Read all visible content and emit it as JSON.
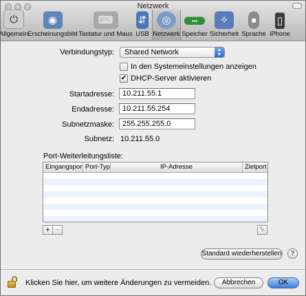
{
  "window": {
    "title": "Netzwerk"
  },
  "toolbar": {
    "items": [
      {
        "label": "Allgemein",
        "icon": "switch-icon",
        "color": "#bdbdbd"
      },
      {
        "label": "Erscheinungsbild",
        "icon": "monitor-icon",
        "color": "#5c86b8"
      },
      {
        "label": "Tastatur und Maus",
        "icon": "keyboard-icon",
        "color": "#9a9a9a"
      },
      {
        "label": "USB",
        "icon": "usb-icon",
        "color": "#4b76b8"
      },
      {
        "label": "Netzwerk",
        "icon": "globe-icon",
        "color": "#6d8fb6"
      },
      {
        "label": "Speicher",
        "icon": "memory-icon",
        "color": "#2f8f3f"
      },
      {
        "label": "Sicherheit",
        "icon": "wrench-icon",
        "color": "#5a7ab8"
      },
      {
        "label": "Sprache",
        "icon": "microphone-icon",
        "color": "#7d7d7d"
      },
      {
        "label": "iPhone",
        "icon": "phone-icon",
        "color": "#3a3a3a"
      }
    ]
  },
  "form": {
    "connection_type_label": "Verbindungstyp:",
    "connection_type_value": "Shared Network",
    "checkbox_show_label": "In den Systemeinstellungen anzeigen",
    "checkbox_show_checked": false,
    "checkbox_dhcp_label": "DHCP-Server aktivieren",
    "checkbox_dhcp_checked": true,
    "start_label": "Startadresse:",
    "start_value": "10.211.55.1",
    "end_label": "Endadresse:",
    "end_value": "10.211.55.254",
    "mask_label": "Subnetzmaske:",
    "mask_value": "255.255.255.0",
    "subnet_label": "Subnetz:",
    "subnet_value": "10.211.55.0"
  },
  "port_forwarding": {
    "title": "Port-Weiterleitungsliste:",
    "columns": [
      "Eingangsport",
      "Port-Typ",
      "IP-Adresse",
      "Zielport"
    ],
    "add_label": "+",
    "remove_label": "−",
    "edit_label": "✎"
  },
  "buttons": {
    "restore_defaults": "Standard wiederherstellen",
    "help": "?",
    "cancel": "Abbrechen",
    "ok": "OK"
  },
  "lock": {
    "text": "Klicken Sie hier, um weitere Änderungen zu vermeiden."
  },
  "colors": {
    "accent": "#3d7fdc",
    "active_tab": "#a9a9a9"
  }
}
